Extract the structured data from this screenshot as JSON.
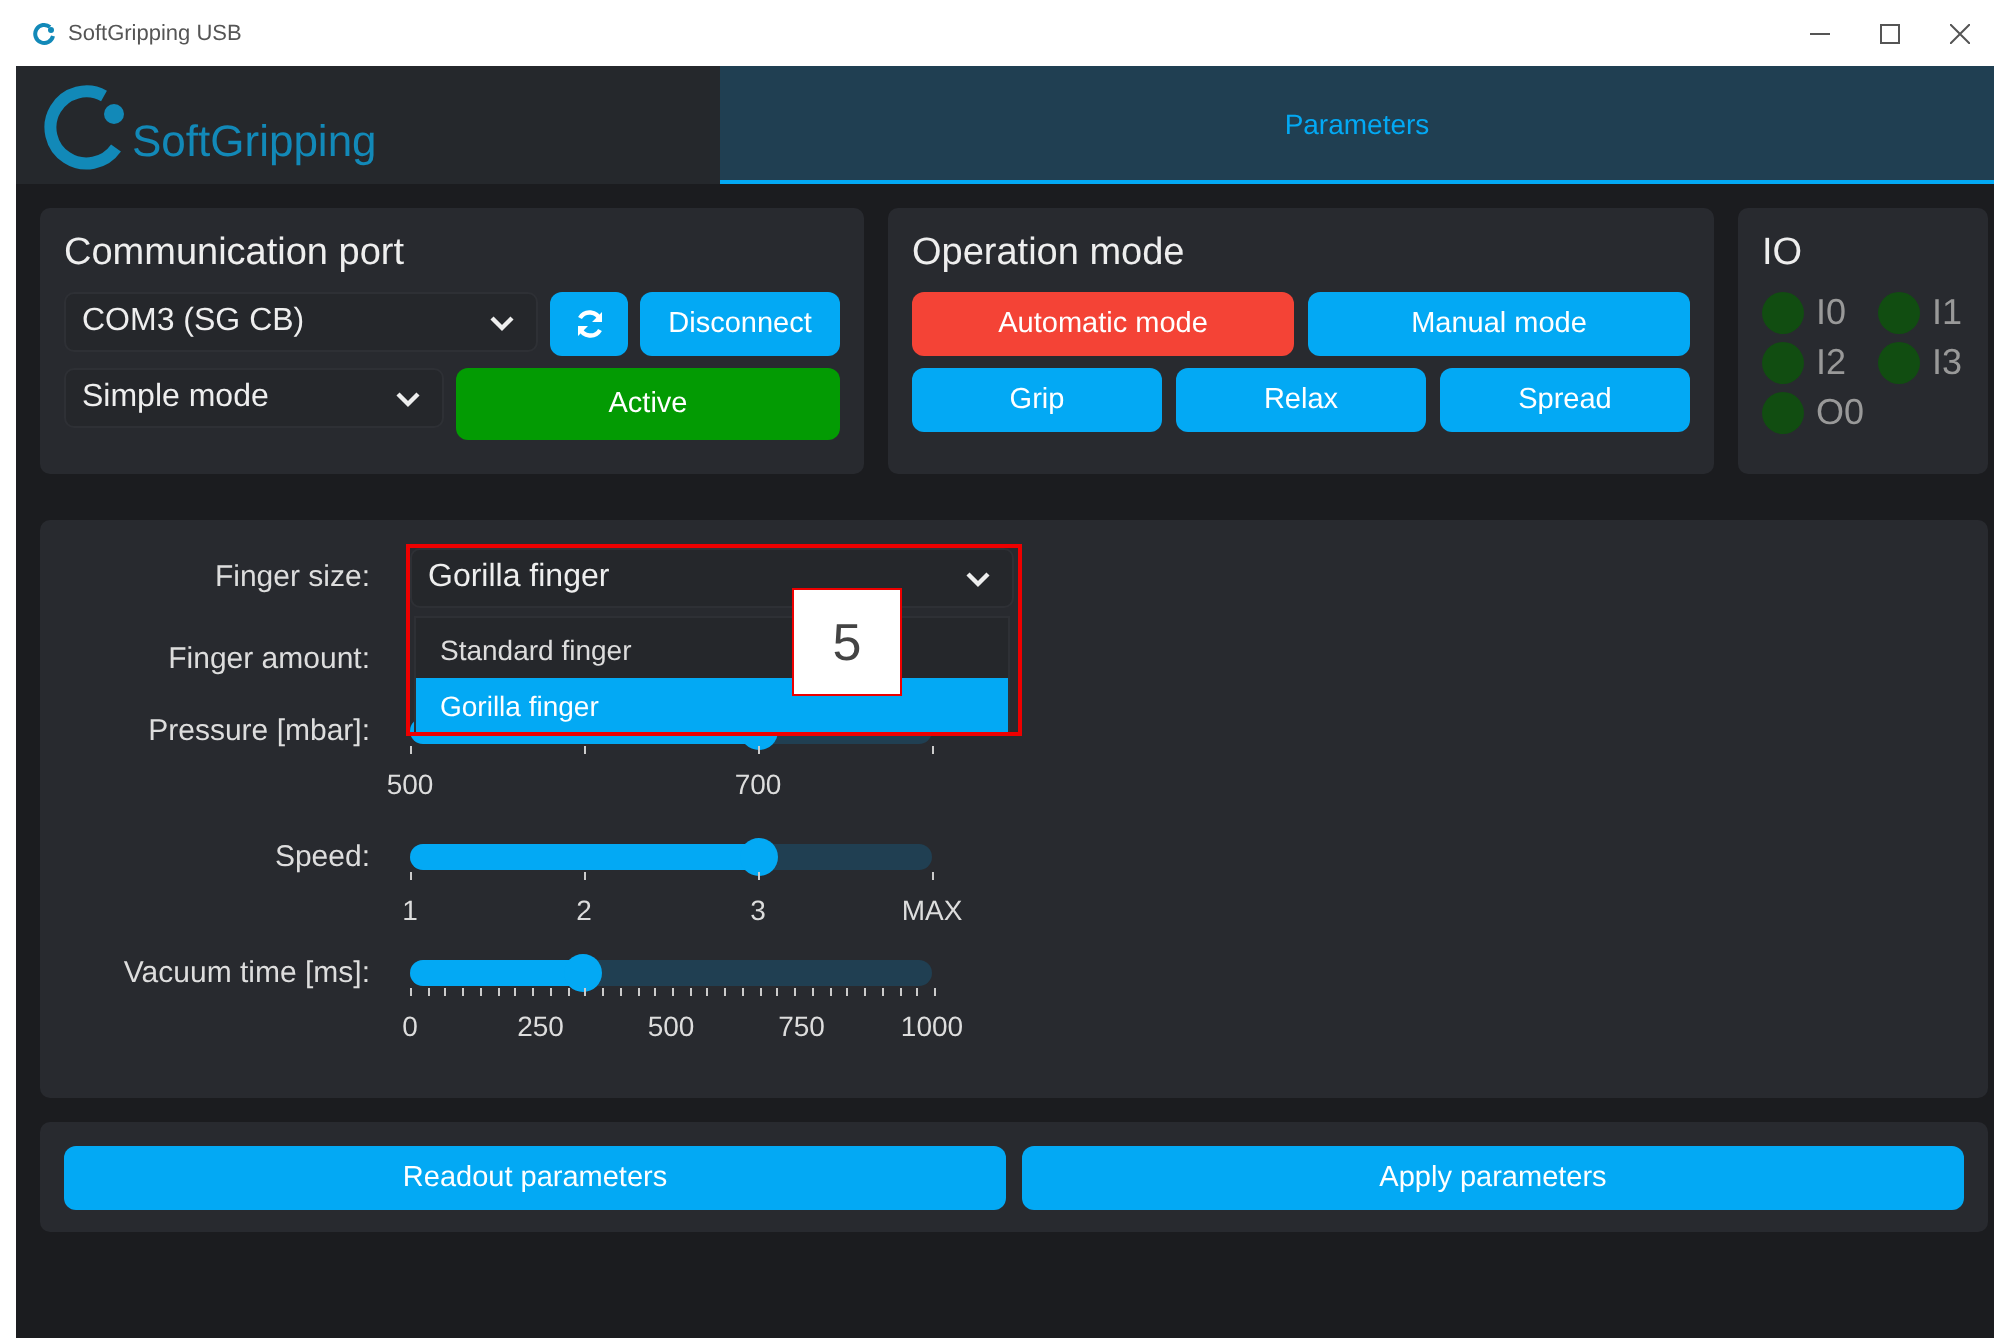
{
  "window": {
    "title": "SoftGripping USB"
  },
  "header": {
    "logo_text": "SoftGripping",
    "tabs": [
      {
        "label": "Parameters",
        "selected": true
      }
    ]
  },
  "communication": {
    "title": "Communication port",
    "port": "COM3 (SG CB)",
    "disconnect": "Disconnect",
    "mode": "Simple mode",
    "status": {
      "label": "Active",
      "on": true
    }
  },
  "operation": {
    "title": "Operation mode",
    "modes": [
      {
        "label": "Automatic mode",
        "selected": true
      },
      {
        "label": "Manual mode",
        "selected": false
      }
    ],
    "actions": [
      "Grip",
      "Relax",
      "Spread"
    ]
  },
  "io": {
    "title": "IO",
    "signals": [
      {
        "label": "I0",
        "on": false
      },
      {
        "label": "I1",
        "on": false
      },
      {
        "label": "I2",
        "on": false
      },
      {
        "label": "I3",
        "on": false
      },
      {
        "label": "O0",
        "on": false
      }
    ]
  },
  "parameters": [
    {
      "kind": "select",
      "label": "Finger size:",
      "value": "Gorilla finger",
      "expanded": true,
      "options": [
        {
          "label": "Standard finger",
          "selected": false
        },
        {
          "label": "Gorilla finger",
          "selected": true
        }
      ]
    },
    {
      "kind": "hidden",
      "label": "Finger amount:"
    },
    {
      "kind": "slider",
      "label": "Pressure [mbar]:",
      "level": 0.667,
      "ticks": [
        {
          "kind": "labeled",
          "label": "500"
        },
        {
          "kind": "blank"
        },
        {
          "kind": "labeled",
          "label": "700"
        },
        {
          "kind": "blank"
        }
      ]
    },
    {
      "kind": "slider",
      "label": "Speed:",
      "level": 0.667,
      "ticks": [
        {
          "kind": "labeled",
          "label": "1"
        },
        {
          "kind": "labeled",
          "label": "2"
        },
        {
          "kind": "labeled",
          "label": "3"
        },
        {
          "kind": "labeled",
          "label": "MAX"
        }
      ]
    },
    {
      "kind": "slider",
      "label": "Vacuum time [ms]:",
      "level": 0.33,
      "minor_ticks": true,
      "ticks": [
        {
          "kind": "labeled",
          "label": "0"
        },
        {
          "kind": "labeled",
          "label": "250"
        },
        {
          "kind": "labeled",
          "label": "500"
        },
        {
          "kind": "labeled",
          "label": "750"
        },
        {
          "kind": "labeled",
          "label": "1000"
        }
      ]
    }
  ],
  "annotation": {
    "label": "5"
  },
  "buttons": [
    "Readout parameters",
    "Apply parameters"
  ]
}
